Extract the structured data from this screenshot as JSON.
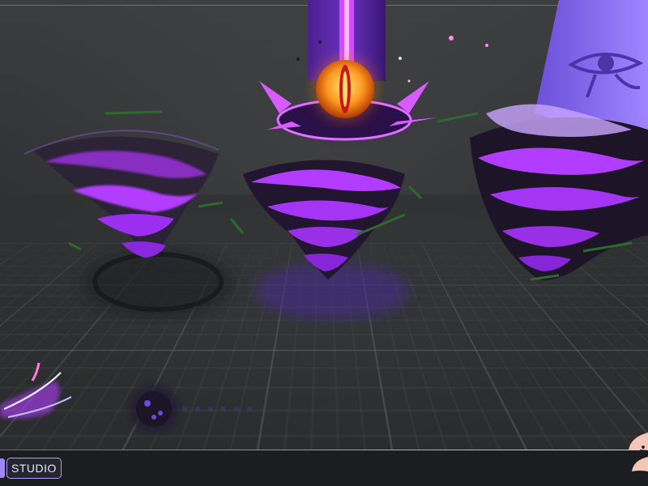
{
  "brand": {
    "label": "STUDIO"
  },
  "colors": {
    "accent_purple": "#b23cff",
    "eye_orange": "#ff8a1c",
    "floor": "#2e3031"
  }
}
